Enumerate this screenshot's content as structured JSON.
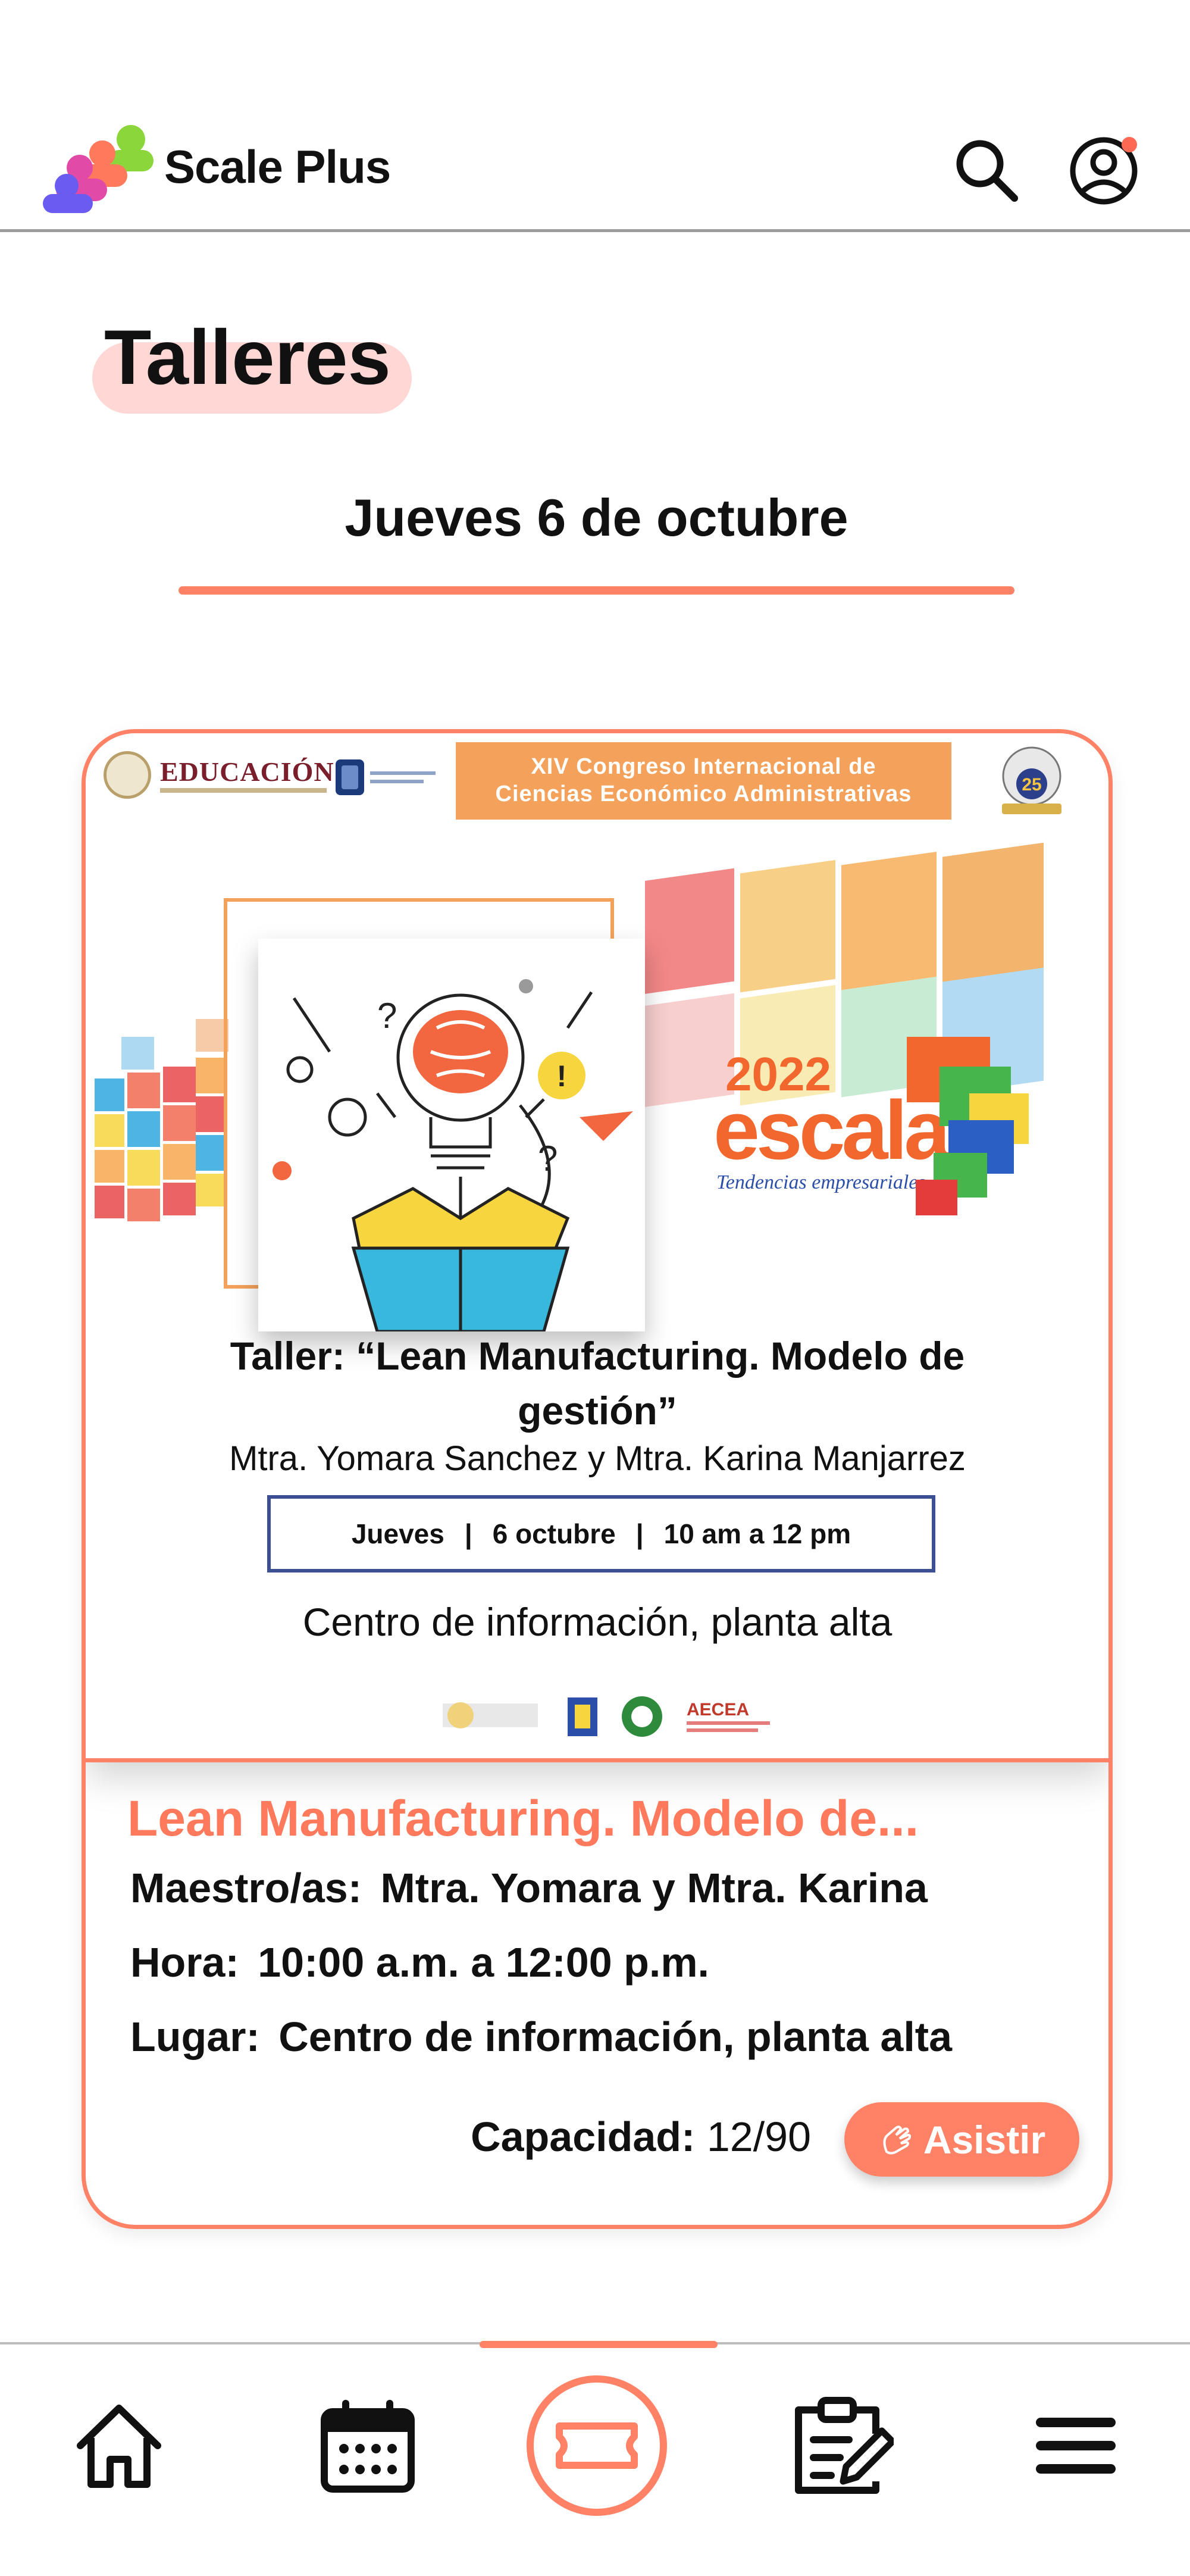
{
  "header": {
    "app_name": "Scale Plus",
    "search_icon": "search-icon",
    "profile_icon": "user-circle-icon",
    "accent_color": "#ff8266"
  },
  "page": {
    "title": "Talleres",
    "day_tab": "Jueves 6 de octubre"
  },
  "poster": {
    "org_label": "EDUCACIÓN",
    "congress_line1": "XIV Congreso Internacional de",
    "congress_line2": "Ciencias Económico Administrativas",
    "anniversary": "25",
    "escala_year": "2022",
    "escala_name": "escala",
    "escala_tagline": "Tendencias empresariales",
    "title": "Taller: “Lean Manufacturing. Modelo de gestión”",
    "speakers": "Mtra. Yomara Sanchez y Mtra. Karina Manjarrez",
    "schedule": {
      "day": "Jueves",
      "date": "6 octubre",
      "time": "10 am a 12 pm"
    },
    "venue": "Centro de información, planta alta",
    "sponsor_label": "AECEA"
  },
  "workshop": {
    "title": "Lean Manufacturing. Modelo de...",
    "teachers_label": "Maestro/as:",
    "teachers_value": "Mtra. Yomara y Mtra. Karina",
    "time_label": "Hora:",
    "time_value": "10:00 a.m. a 12:00 p.m.",
    "place_label": "Lugar:",
    "place_value": "Centro de información, planta alta",
    "capacity_label": "Capacidad:",
    "capacity_value": "12/90",
    "attend_button": "Asistir"
  },
  "bottom_nav": {
    "items": [
      {
        "icon": "home-icon",
        "active": false
      },
      {
        "icon": "calendar-icon",
        "active": false
      },
      {
        "icon": "ticket-icon",
        "active": true
      },
      {
        "icon": "clipboard-edit-icon",
        "active": false
      },
      {
        "icon": "menu-icon",
        "active": false
      }
    ]
  }
}
